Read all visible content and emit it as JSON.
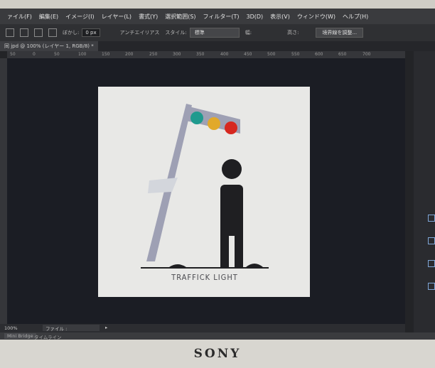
{
  "menu": [
    "ァイル(F)",
    "編集(E)",
    "イメージ(I)",
    "レイヤー(L)",
    "書式(Y)",
    "選択範囲(S)",
    "フィルター(T)",
    "3D(D)",
    "表示(V)",
    "ウィンドウ(W)",
    "ヘルプ(H)"
  ],
  "options": {
    "blur_label": "ぼかし:",
    "blur_value": "0 px",
    "antialias_label": "アンチエイリアス",
    "style_label": "スタイル:",
    "style_value": "標準",
    "width_label": "幅:",
    "height_label": "高さ:",
    "refine_button": "境界線を調整..."
  },
  "document_tab": "同 jpd @ 100% (レイヤー 1, RGB/8) *",
  "ruler_ticks": [
    "50",
    "0",
    "50",
    "100",
    "150",
    "200",
    "250",
    "300",
    "350",
    "400",
    "450",
    "500",
    "550",
    "600",
    "650",
    "700"
  ],
  "artwork": {
    "caption": "TRAFFICK LIGHT",
    "colors": {
      "background": "#e8e8e6",
      "pole": "#9ea0b4",
      "figure": "#1f1f22",
      "light_green": "#1f9a8e",
      "light_yellow": "#e1a92a",
      "light_red": "#d6271f"
    }
  },
  "status": {
    "zoom": "100%",
    "doc_info": "ファイル : 732.4K/1.13M",
    "arrow": "▸"
  },
  "bottom": {
    "mini_bridge": "Mini Bridge",
    "timeline": "タイムライン"
  },
  "brand": "SONY"
}
